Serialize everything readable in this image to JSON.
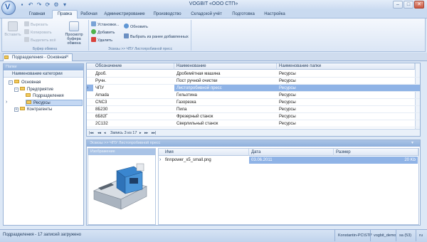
{
  "window": {
    "title": "VOGBIT «ООО СТП»"
  },
  "quick_access": [
    "save-icon",
    "undo-icon",
    "redo-icon",
    "refresh-icon",
    "settings-icon",
    "dropdown-icon"
  ],
  "menu_tabs": [
    "Главная",
    "Правка",
    "Рабочая",
    "Администрирование",
    "Производство",
    "Складской учёт",
    "Подготовка",
    "Настройка"
  ],
  "ribbon": {
    "clipboard": {
      "paste_label": "Вставить",
      "cut_label": "Вырезать",
      "copy_label": "Копировать",
      "select_all_label": "Выделить всё",
      "preview_label": "Просмотр буфера обмена",
      "group_label": "Буфер обмена"
    },
    "samples": {
      "settings_label": "Установки...",
      "add_label": "Добавить",
      "delete_label": "Удалить",
      "refresh_label": "Обновить",
      "select_from_added_label": "Выбрать из ранее добавленных",
      "group_label": "Эскизы >> ЧПУ Листопробивной пресс"
    }
  },
  "document_tab": {
    "label": "Подразделения - Основная"
  },
  "left_panel": {
    "header": "Папки",
    "column_header": "Наименование категории",
    "tree": [
      {
        "label": "Основная",
        "level": 0,
        "expander": "−"
      },
      {
        "label": "Предприятие",
        "level": 1,
        "expander": "−"
      },
      {
        "label": "Подразделения",
        "level": 2,
        "expander": ""
      },
      {
        "label": "Ресурсы",
        "level": 2,
        "expander": ""
      },
      {
        "label": "Контрагенты",
        "level": 1,
        "expander": "+"
      }
    ]
  },
  "grid": {
    "columns": [
      "Обозначение",
      "Наименование",
      "Наименование папки"
    ],
    "rows": [
      [
        "Дроб.",
        "Дробемётная машина",
        "Ресурсы"
      ],
      [
        "Ручн.",
        "Пост ручной очистки",
        "Ресурсы"
      ],
      [
        "ЧПУ",
        "Листопробивной пресс",
        "Ресурсы"
      ],
      [
        "Amada",
        "Гильотина",
        "Ресурсы"
      ],
      [
        "CNC3",
        "Газорезка",
        "Ресурсы"
      ],
      [
        "8Б230",
        "Пила",
        "Ресурсы"
      ],
      [
        "6Б82Г",
        "Фрезерный станок",
        "Ресурсы"
      ],
      [
        "2С132",
        "Сверлильный станок",
        "Ресурсы"
      ]
    ],
    "selected_row": 2,
    "record_nav": "Запись 3 из 17"
  },
  "detail": {
    "header": "Эскизы >> ЧПУ Листопробивной пресс",
    "image_header": "Изображение",
    "files_columns": [
      "Имя",
      "Дата",
      "Размер"
    ],
    "file": {
      "name": "finnpower_x5_small.png",
      "date": "03.06.2011",
      "size": "20 Kb"
    }
  },
  "status": {
    "text": "Подразделения - 17 записей загружено",
    "computer": "Konstantin-PC\\STP",
    "database": "vogbit_demo",
    "session": "sa (53)",
    "lang": "ru"
  },
  "colors": {
    "accent": "#8fb3e6",
    "frame": "#dde8f6",
    "border": "#98b2d6"
  }
}
